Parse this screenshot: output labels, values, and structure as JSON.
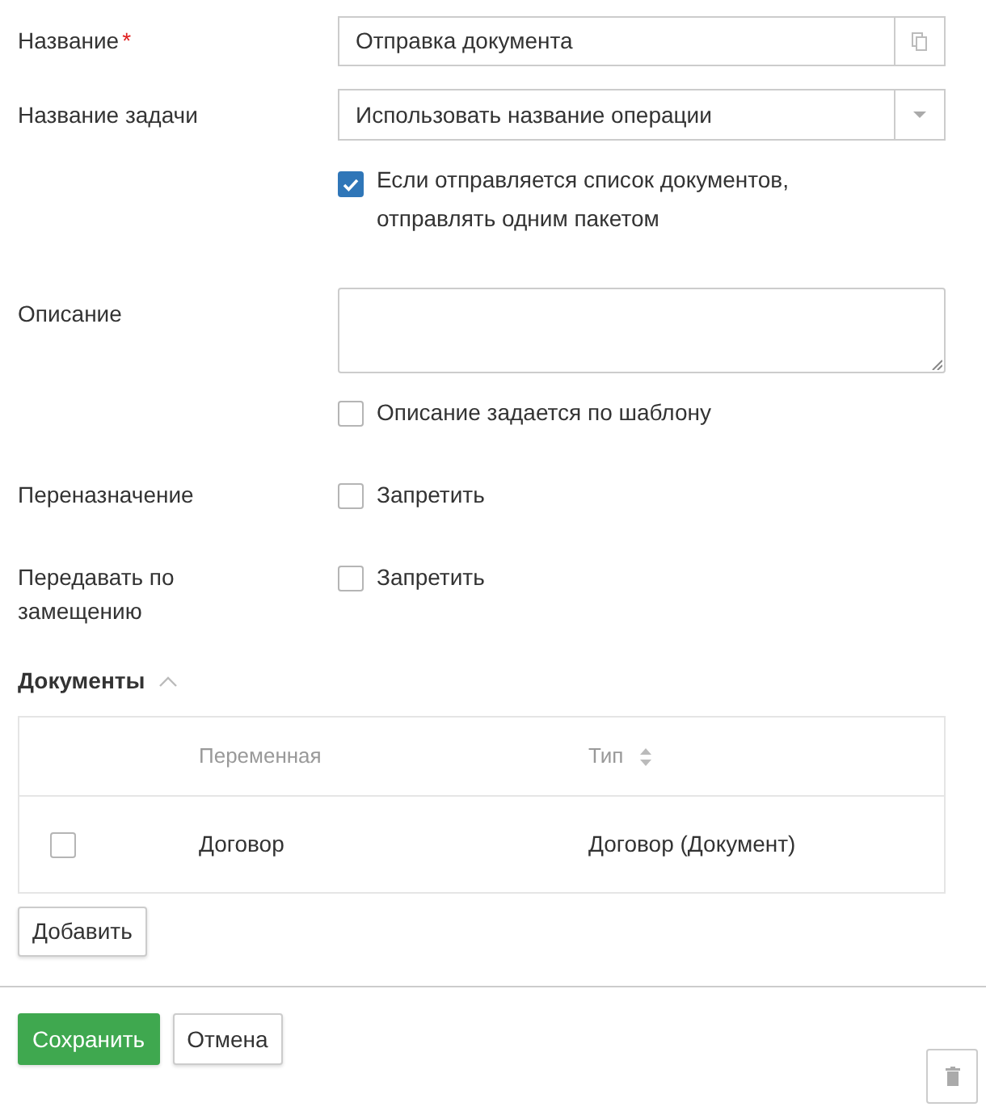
{
  "rows": [
    {
      "kind": "text",
      "label": "Название",
      "required_mark": "*",
      "value": "Отправка документа"
    },
    {
      "kind": "select",
      "label": "Название задачи",
      "value": "Использовать название операции"
    },
    {
      "kind": "checkbox",
      "text": "Если отправляется список документов, отправлять одним пакетом",
      "checked": true
    },
    {
      "kind": "textarea",
      "label": "Описание"
    },
    {
      "kind": "checkbox",
      "text": "Описание задается по шаблону",
      "checked": false
    },
    {
      "kind": "checkbox",
      "label": "Переназначение",
      "text": "Запретить",
      "checked": false
    },
    {
      "kind": "checkbox",
      "label": "Передавать по замещению",
      "text": "Запретить",
      "checked": false
    }
  ],
  "documents": {
    "title": "Документы",
    "expanded": true,
    "columns": [
      {
        "label": "Переменная",
        "sortable": false
      },
      {
        "label": "Тип",
        "sortable": true
      }
    ],
    "rows": [
      {
        "checked": false,
        "cells": [
          "Договор",
          "Договор (Документ)"
        ]
      }
    ],
    "add_button": "Добавить"
  },
  "buttons": [
    {
      "kind": "primary",
      "label": "Сохранить"
    },
    {
      "kind": "default",
      "label": "Отмена"
    }
  ]
}
